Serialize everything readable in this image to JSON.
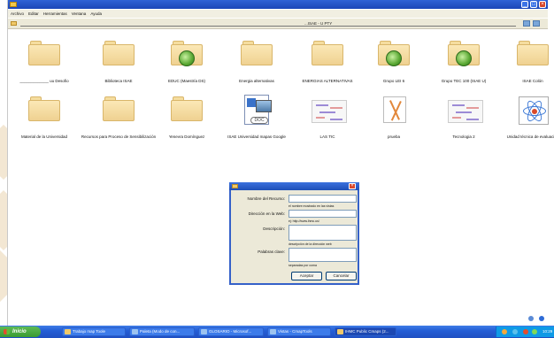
{
  "menu": [
    "Archivo",
    "Editar",
    "Herramientas",
    "Ventana",
    "Ayuda"
  ],
  "window_title": "...ISAE - U PTY",
  "tiles_row1": [
    {
      "label": "_____________ uu Desofio",
      "icon": "folder-icon"
    },
    {
      "label": "Biblioteca ISAE",
      "icon": "folder-icon"
    },
    {
      "label": "EDUC (Maestría DS)",
      "icon": "globe-folder-icon"
    },
    {
      "label": "Energia alternativas",
      "icon": "folder-icon"
    },
    {
      "label": "ENERGIAS ALTERNATIVAS",
      "icon": "folder-icon"
    },
    {
      "label": "Grupo LEI 6",
      "icon": "globe-folder-icon"
    },
    {
      "label": "Grupo TEC 100 (ISAE U)",
      "icon": "globe-folder-icon"
    },
    {
      "label": "ISAE Colón",
      "icon": "folder-icon"
    }
  ],
  "tiles_row2": [
    {
      "label": "Material de la Universidad",
      "icon": "folder-icon"
    },
    {
      "label": "Recursos para Proceso de Sensibilización",
      "icon": "folder-icon"
    },
    {
      "label": "Yenevra Domínguez",
      "icon": "folder-icon"
    },
    {
      "label": "ISAE Universidad mapas Google",
      "icon": "doc-icon",
      "doc_text": "DOC"
    },
    {
      "label": "LAS TIC",
      "icon": "concept-map-icon"
    },
    {
      "label": "prueba",
      "icon": "drawing-icon"
    },
    {
      "label": "Tecnologia 2",
      "icon": "concept-map-icon"
    },
    {
      "label": "Unidad técnica de evaluación",
      "icon": "atom-icon"
    }
  ],
  "dialog": {
    "fields": [
      {
        "label": "Nombre del Recurso:",
        "hint": "el nombre mostrado en las vistas"
      },
      {
        "label": "Dirección en la Web:",
        "hint": "ej: http://www.ihmc.us/"
      },
      {
        "label": "Descripción:",
        "hint": "descripción de la dirección web"
      },
      {
        "label": "Palabras clave:",
        "hint": "separadas por coma"
      }
    ],
    "accept": "Aceptar",
    "cancel": "Cancelar"
  },
  "taskbar": {
    "start": "Inicio",
    "tasks": [
      {
        "label": "Trabajo map Toole",
        "color": "#f0c96a"
      },
      {
        "label": "Paleta (Modo de con...",
        "color": "#9cc3f0"
      },
      {
        "label": "GLOSARIO - Microsof...",
        "color": "#9cc3f0"
      },
      {
        "label": "Vistas - CmapTools",
        "color": "#9cc3f0"
      },
      {
        "label": "IHMC Public Cmaps (2...",
        "color": "#f0c96a",
        "active": true
      }
    ],
    "clock": "10:29"
  },
  "colors": {
    "titlebar": "#2f62d6",
    "taskbar": "#245ed6",
    "start": "#3a9a31"
  }
}
